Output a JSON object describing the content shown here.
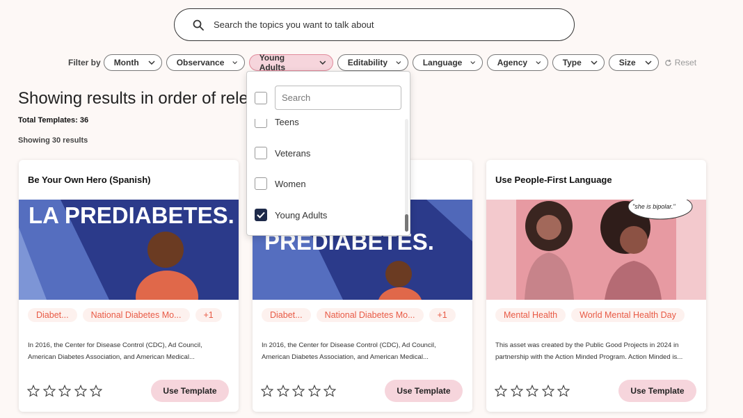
{
  "search": {
    "placeholder": "Search the topics you want to talk about"
  },
  "filters": {
    "label": "Filter by",
    "chips": [
      {
        "label": "Month"
      },
      {
        "label": "Observance"
      },
      {
        "label": "Young Adults",
        "active": true
      },
      {
        "label": "Editability"
      },
      {
        "label": "Language"
      },
      {
        "label": "Agency"
      },
      {
        "label": "Type"
      },
      {
        "label": "Size"
      }
    ],
    "reset": "Reset"
  },
  "results": {
    "heading": "Showing results in order of relevance",
    "total": "Total Templates: 36",
    "showing": "Showing 30 results"
  },
  "dropdown": {
    "search_placeholder": "Search",
    "items": [
      {
        "label": "Teens",
        "checked": false
      },
      {
        "label": "Veterans",
        "checked": false
      },
      {
        "label": "Women",
        "checked": false
      },
      {
        "label": "Young Adults",
        "checked": true
      }
    ]
  },
  "cards": [
    {
      "title": "Be Your Own Hero (Spanish)",
      "image_text": "LA PREDIABETES.",
      "tags": [
        "Diabet...",
        "National Diabetes Mo...",
        "+1"
      ],
      "description": "In 2016, the Center for Disease Control (CDC), Ad Council, American Diabetes Association, and American Medical...",
      "button": "Use Template"
    },
    {
      "title": "",
      "image_text": "PREDIABETES.",
      "tags": [
        "Diabet...",
        "National Diabetes Mo...",
        "+1"
      ],
      "description": "In 2016, the Center for Disease Control (CDC), Ad Council, American Diabetes Association, and American Medical...",
      "button": "Use Template"
    },
    {
      "title": "Use People-First Language",
      "image_text": "\"she is bipolar.\"",
      "tags": [
        "Mental Health",
        "World Mental Health Day"
      ],
      "description": "This asset was created by the Public Good Projects in 2024 in partnership with the Action Minded Program. Action Minded is...",
      "button": "Use Template"
    }
  ],
  "colors": {
    "accent_pink": "#f6d5dc",
    "tag_text": "#e85a45",
    "banner_blue": "#2b3a8a",
    "check_navy": "#1e2a4a"
  },
  "icons": [
    "search-icon",
    "chevron-down-icon",
    "reset-icon",
    "star-icon",
    "check-icon"
  ]
}
